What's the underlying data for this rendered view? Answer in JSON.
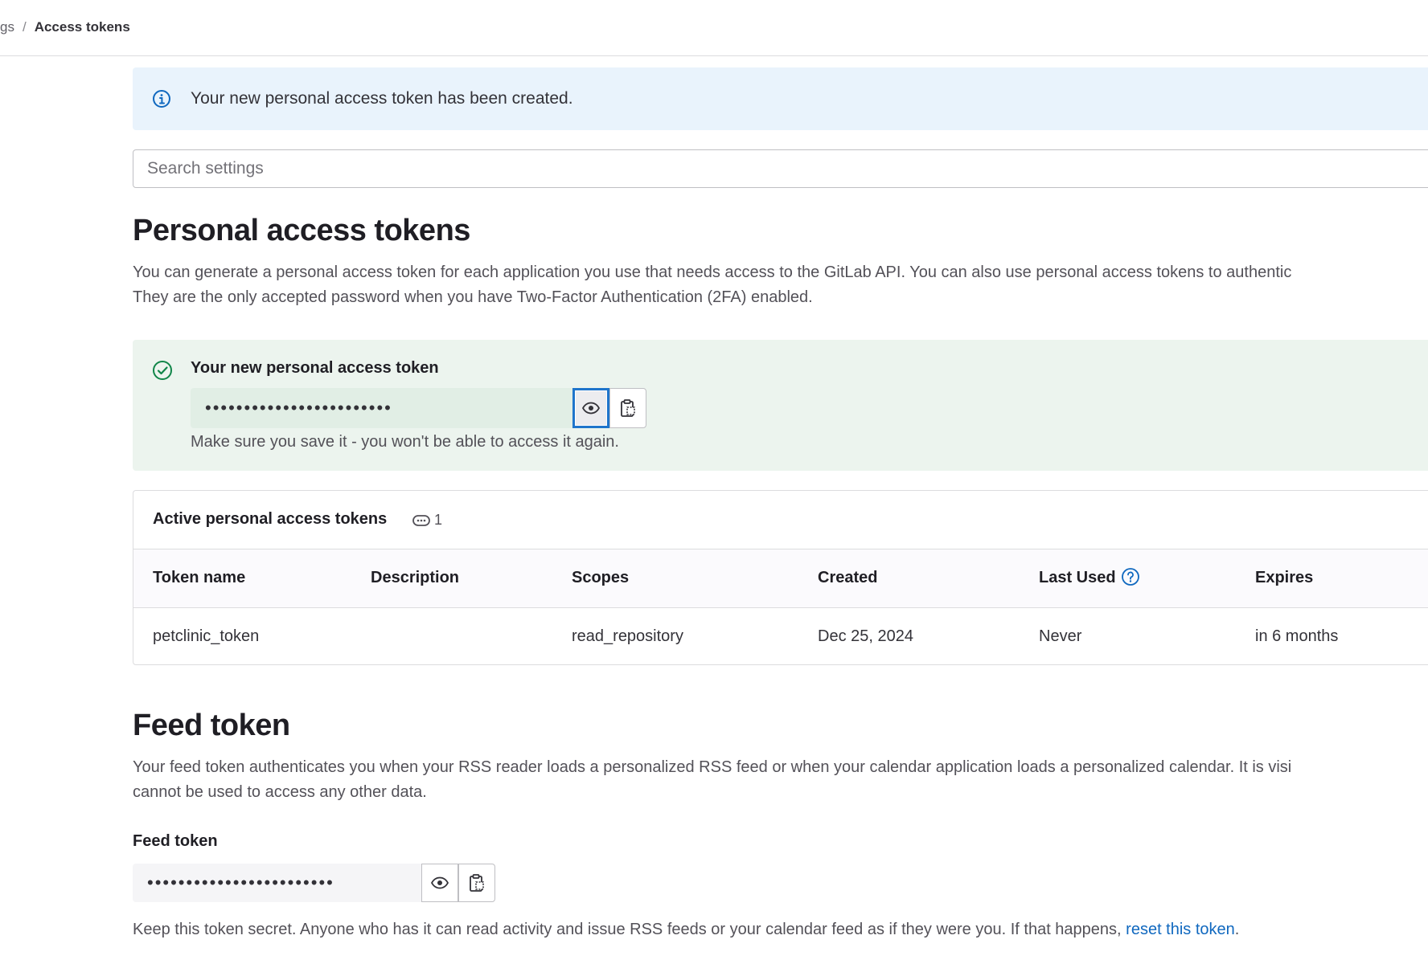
{
  "breadcrumb": {
    "parent": "gs",
    "separator": "/",
    "current": "Access tokens"
  },
  "alert": {
    "message": "Your new personal access token has been created."
  },
  "search": {
    "placeholder": "Search settings"
  },
  "pat": {
    "title": "Personal access tokens",
    "description_line1": "You can generate a personal access token for each application you use that needs access to the GitLab API. You can also use personal access tokens to authentic",
    "description_line2": "They are the only accepted password when you have Two-Factor Authentication (2FA) enabled."
  },
  "new_token": {
    "label": "Your new personal access token",
    "masked_value": "••••••••••••••••••••••••",
    "note": "Make sure you save it - you won't be able to access it again."
  },
  "active_tokens": {
    "title": "Active personal access tokens",
    "count": "1",
    "columns": [
      "Token name",
      "Description",
      "Scopes",
      "Created",
      "Last Used",
      "Expires"
    ],
    "rows": [
      [
        "petclinic_token",
        "",
        "read_repository",
        "Dec 25, 2024",
        "Never",
        "in 6 months"
      ]
    ]
  },
  "feed": {
    "title": "Feed token",
    "description_line1": "Your feed token authenticates you when your RSS reader loads a personalized RSS feed or when your calendar application loads a personalized calendar. It is visi",
    "description_line2": "cannot be used to access any other data.",
    "label": "Feed token",
    "masked_value": "••••••••••••••••••••••••",
    "help_text": "Keep this token secret. Anyone who has it can read activity and issue RSS feeds or your calendar feed as if they were you. If that happens, ",
    "reset_link": "reset this token",
    "help_end": "."
  },
  "icons": {
    "info": "info-icon",
    "success": "check-circle-icon",
    "reveal": "eye-icon",
    "copy": "clipboard-icon",
    "count": "token-icon",
    "help": "question-icon"
  },
  "colors": {
    "info_bg": "#e9f3fc",
    "success_bg": "#ecf4ee",
    "link": "#1068bf",
    "focus": "#1f75cb",
    "success_icon": "#108548"
  }
}
